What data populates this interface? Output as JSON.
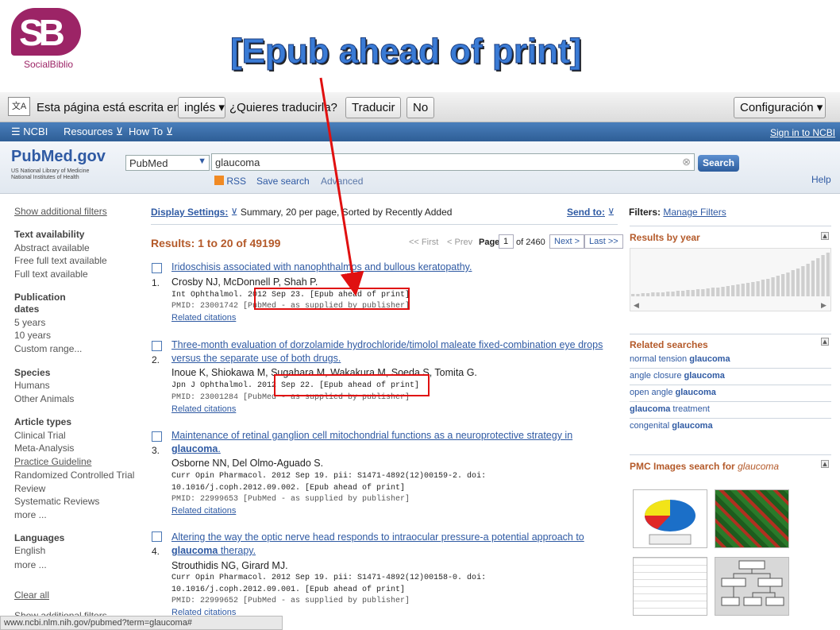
{
  "slide": {
    "logo_letters": "SB",
    "logo_caption": "SocialBiblio",
    "title": "[Epub ahead of print]",
    "annotation_color": "#e01010"
  },
  "translate_bar": {
    "message": "Esta página está escrita en",
    "language": "inglés",
    "question": "¿Quieres traducirla?",
    "translate_button": "Traducir",
    "no_button": "No",
    "settings_button": "Configuración"
  },
  "ncbi_bar": {
    "brand": "NCBI",
    "resources": "Resources",
    "howto": "How To",
    "signin": "Sign in to NCBI"
  },
  "search": {
    "logo": "PubMed.gov",
    "logo_sub1": "US National Library of Medicine",
    "logo_sub2": "National Institutes of Health",
    "database": "PubMed",
    "query": "glaucoma",
    "button": "Search",
    "rss": "RSS",
    "save_search": "Save search",
    "advanced": "Advanced",
    "help": "Help"
  },
  "left_filters": {
    "show_additional": "Show additional filters",
    "text_availability": {
      "heading": "Text availability",
      "items": [
        "Abstract available",
        "Free full text available",
        "Full text available"
      ]
    },
    "publication_dates": {
      "heading1": "Publication",
      "heading2": "dates",
      "items": [
        "5 years",
        "10 years",
        "Custom range..."
      ]
    },
    "species": {
      "heading": "Species",
      "items": [
        "Humans",
        "Other Animals"
      ]
    },
    "article_types": {
      "heading": "Article types",
      "items": [
        "Clinical Trial",
        "Meta-Analysis",
        "Practice Guideline",
        "Randomized Controlled Trial",
        "Review",
        "Systematic Reviews",
        "more ..."
      ]
    },
    "languages": {
      "heading": "Languages",
      "items": [
        "English",
        "more ..."
      ]
    },
    "clear_all": "Clear all",
    "show_additional_bottom": "Show additional filters"
  },
  "results_bar": {
    "display_settings": "Display Settings:",
    "display_value": "Summary, 20 per page, Sorted by Recently Added",
    "send_to": "Send to:",
    "count": "Results: 1 to 20 of 49199",
    "first": "<< First",
    "prev": "< Prev",
    "page_label": "Page",
    "page": "1",
    "of_pages": "of 2460",
    "next": "Next >",
    "last": "Last >>"
  },
  "results": [
    {
      "num": "1.",
      "title": "Iridoschisis associated with nanophthalmos and bullous keratopathy.",
      "authors": "Crosby NJ, McDonnell P, Shah P.",
      "source": "Int Ophthalmol. 2012 Sep 23. [Epub ahead of print]",
      "pmid": "PMID: 23001742 [PubMed - as supplied by publisher]",
      "related": "Related citations"
    },
    {
      "num": "2.",
      "title": "Three-month evaluation of dorzolamide hydrochloride/timolol maleate fixed-combination eye drops versus the separate use of both drugs.",
      "authors": "Inoue K, Shiokawa M, Sugahara M, Wakakura M, Soeda S, Tomita G.",
      "source": "Jpn J Ophthalmol. 2012 Sep 22. [Epub ahead of print]",
      "pmid": "PMID: 23001284 [PubMed - as supplied by publisher]",
      "related": "Related citations"
    },
    {
      "num": "3.",
      "title": "Maintenance of retinal ganglion cell mitochondrial functions as a neuroprotective strategy in glaucoma.",
      "authors": "Osborne NN, Del Olmo-Aguado S.",
      "source": "Curr Opin Pharmacol. 2012 Sep 19. pii: S1471-4892(12)00159-2. doi: 10.1016/j.coph.2012.09.002. [Epub ahead of print]",
      "pmid": "PMID: 22999653 [PubMed - as supplied by publisher]",
      "related": "Related citations"
    },
    {
      "num": "4.",
      "title": "Altering the way the optic nerve head responds to intraocular pressure-a potential approach to glaucoma therapy.",
      "authors": "Strouthidis NG, Girard MJ.",
      "source": "Curr Opin Pharmacol. 2012 Sep 19. pii: S1471-4892(12)00158-0. doi: 10.1016/j.coph.2012.09.001. [Epub ahead of print]",
      "pmid": "PMID: 22999652 [PubMed - as supplied by publisher]",
      "related": "Related citations"
    }
  ],
  "right_col": {
    "filters_label": "Filters:",
    "manage_filters": "Manage Filters",
    "results_by_year": "Results by year",
    "year_bars": [
      3,
      3,
      4,
      4,
      5,
      5,
      5,
      6,
      6,
      7,
      7,
      8,
      8,
      9,
      9,
      10,
      11,
      11,
      12,
      13,
      14,
      15,
      16,
      17,
      18,
      19,
      21,
      22,
      24,
      26,
      28,
      30,
      33,
      35,
      38,
      41,
      45,
      48,
      52,
      55
    ],
    "related_heading": "Related searches",
    "related": [
      {
        "pre": "normal tension ",
        "bold": "glaucoma",
        "post": ""
      },
      {
        "pre": "angle closure ",
        "bold": "glaucoma",
        "post": ""
      },
      {
        "pre": "open angle ",
        "bold": "glaucoma",
        "post": ""
      },
      {
        "pre": "",
        "bold": "glaucoma",
        "post": " treatment"
      },
      {
        "pre": "congenital ",
        "bold": "glaucoma",
        "post": ""
      }
    ],
    "pmc_heading": "PMC Images search for",
    "pmc_term": "glaucoma"
  },
  "status_url": "www.ncbi.nlm.nih.gov/pubmed?term=glaucoma#"
}
